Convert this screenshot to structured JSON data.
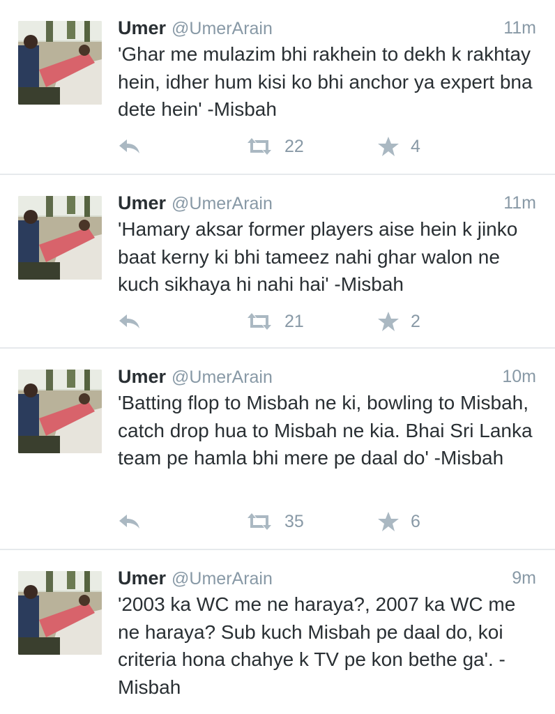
{
  "tweets": [
    {
      "name": "Umer",
      "handle": "@UmerArain",
      "time": "11m",
      "text": "'Ghar me mulazim bhi rakhein to dekh k rakhtay hein, idher hum kisi ko bhi anchor ya expert bna dete hein' -Misbah",
      "retweets": "22",
      "favorites": "4"
    },
    {
      "name": "Umer",
      "handle": "@UmerArain",
      "time": "11m",
      "text": "'Hamary aksar former players aise hein k jinko baat kerny ki bhi tameez nahi ghar walon ne kuch sikhaya hi nahi hai' -Misbah",
      "retweets": "21",
      "favorites": "2"
    },
    {
      "name": "Umer",
      "handle": "@UmerArain",
      "time": "10m",
      "text": "'Batting flop to Misbah ne ki, bowling to Misbah, catch drop hua to Misbah ne kia. Bhai Sri Lanka team pe hamla bhi mere pe daal do' -Misbah",
      "retweets": "35",
      "favorites": "6"
    },
    {
      "name": "Umer",
      "handle": "@UmerArain",
      "time": "9m",
      "text": "'2003 ka WC me ne haraya?, 2007 ka WC me ne haraya? Sub kuch Misbah pe daal do, koi criteria hona chahye k TV pe kon bethe ga'. -Misbah"
    }
  ],
  "icons": {
    "reply": "reply-icon",
    "retweet": "retweet-icon",
    "favorite": "star-icon"
  },
  "colors": {
    "text": "#292f33",
    "muted": "#8899a6",
    "icon": "#aab8c2",
    "divider": "#e6e9ec"
  }
}
